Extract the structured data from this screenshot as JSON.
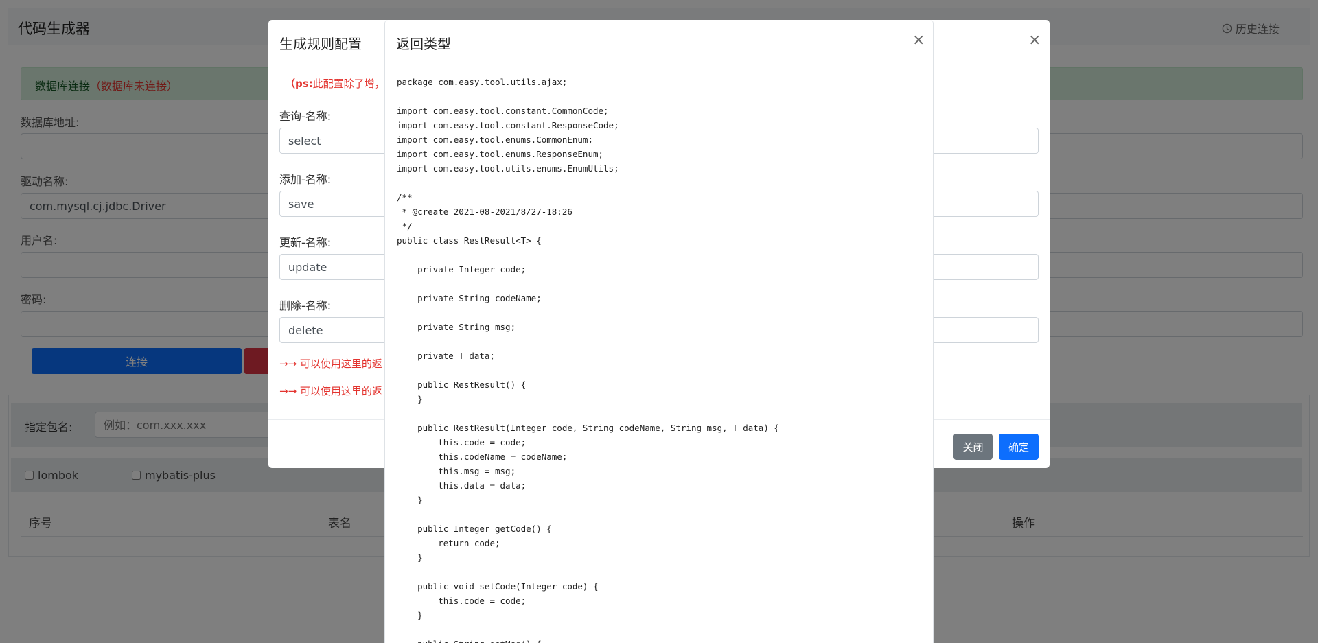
{
  "app": {
    "title": "代码生成器",
    "history_label": "历史连接"
  },
  "db": {
    "alert_prefix": "数据库连接",
    "alert_status": "（数据库未连接）",
    "address_label": "数据库地址:",
    "address_value": "",
    "driver_label": "驱动名称:",
    "driver_value": "com.mysql.cj.jdbc.Driver",
    "user_label": "用户名:",
    "user_value": "",
    "password_label": "密码:",
    "password_value": "",
    "connect_label": "连接"
  },
  "package": {
    "label": "指定包名:",
    "placeholder": "例如：com.xxx.xxx"
  },
  "options": {
    "lombok": "lombok",
    "mybatis_plus": "mybatis-plus"
  },
  "table": {
    "headers": [
      "序号",
      "表名",
      "操作"
    ]
  },
  "rules_modal": {
    "title": "生成规则配置",
    "note_bold": "（ps:",
    "note_text": "此配置除了增，",
    "select_label": "查询-名称:",
    "select_value": "select",
    "save_label": "添加-名称:",
    "save_value": "save",
    "update_label": "更新-名称:",
    "update_value": "update",
    "delete_label": "删除-名称:",
    "delete_value": "delete",
    "hint1": "→→ 可以使用这里的返",
    "hint2": "→→ 可以使用这里的返",
    "close_label": "关闭",
    "ok_label": "确定",
    "close_x": "×"
  },
  "return_modal": {
    "title": "返回类型",
    "close_x": "×",
    "code": "package com.easy.tool.utils.ajax;\n\nimport com.easy.tool.constant.CommonCode;\nimport com.easy.tool.constant.ResponseCode;\nimport com.easy.tool.enums.CommonEnum;\nimport com.easy.tool.enums.ResponseEnum;\nimport com.easy.tool.utils.enums.EnumUtils;\n\n/**\n * @create 2021-08-2021/8/27-18:26\n */\npublic class RestResult<T> {\n\n    private Integer code;\n\n    private String codeName;\n\n    private String msg;\n\n    private T data;\n\n    public RestResult() {\n    }\n\n    public RestResult(Integer code, String codeName, String msg, T data) {\n        this.code = code;\n        this.codeName = codeName;\n        this.msg = msg;\n        this.data = data;\n    }\n\n    public Integer getCode() {\n        return code;\n    }\n\n    public void setCode(Integer code) {\n        this.code = code;\n    }\n\n    public String getMsg() {"
  }
}
